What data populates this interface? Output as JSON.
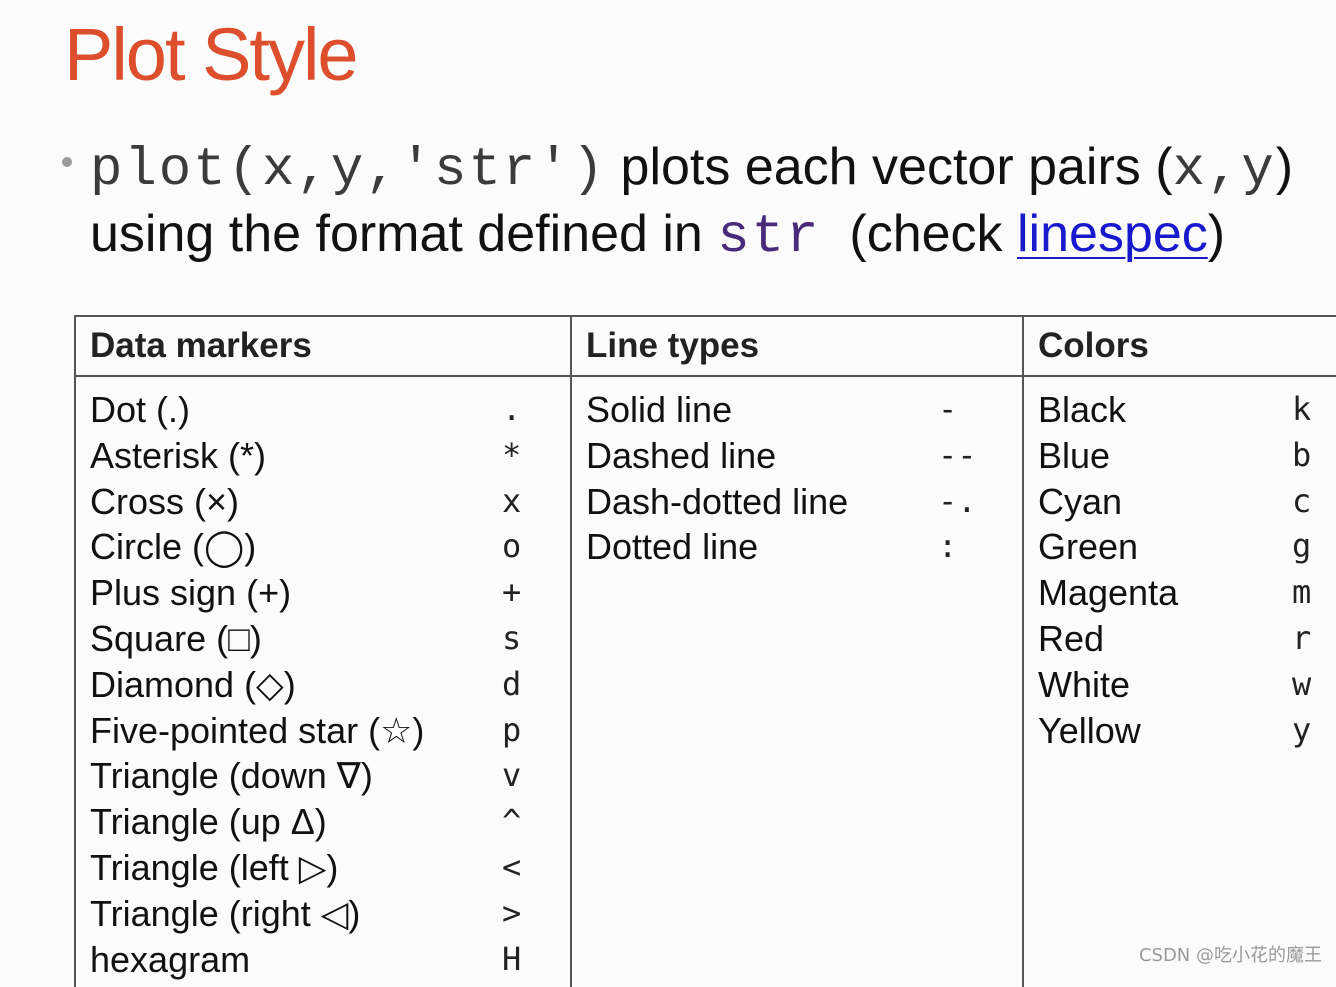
{
  "title": "Plot Style",
  "bullet": {
    "code_call": "plot(x,y,'str')",
    "text_a": " plots each vector pairs (",
    "code_xy": "x,y",
    "text_b": ")",
    "text_c": "using the format defined in ",
    "code_str": "str",
    "text_d": "  (check ",
    "link_text": "linespec",
    "text_e": ")"
  },
  "table": {
    "headers": [
      "Data markers",
      "Line types",
      "Colors"
    ],
    "markers": [
      {
        "label": "Dot (.)",
        "symbol": "."
      },
      {
        "label": "Asterisk (*)",
        "symbol": "*"
      },
      {
        "label": "Cross (×)",
        "symbol": "x"
      },
      {
        "label": "Circle (◯)",
        "symbol": "o"
      },
      {
        "label": "Plus sign (+)",
        "symbol": "+"
      },
      {
        "label": "Square (□)",
        "symbol": "s"
      },
      {
        "label": "Diamond (◇)",
        "symbol": "d"
      },
      {
        "label": "Five-pointed star (☆)",
        "symbol": "p"
      },
      {
        "label": "Triangle (down ∇)",
        "symbol": "v"
      },
      {
        "label": "Triangle (up Δ)",
        "symbol": "^"
      },
      {
        "label": "Triangle (left ▷)",
        "symbol": "<"
      },
      {
        "label": "Triangle (right ◁)",
        "symbol": ">"
      },
      {
        "label": "hexagram",
        "symbol": "H"
      }
    ],
    "line_types": [
      {
        "label": "Solid line",
        "symbol": "-"
      },
      {
        "label": "Dashed line",
        "symbol": "--"
      },
      {
        "label": "Dash-dotted line",
        "symbol": "-."
      },
      {
        "label": "Dotted line",
        "symbol": ":"
      }
    ],
    "colors": [
      {
        "label": "Black",
        "symbol": "k"
      },
      {
        "label": "Blue",
        "symbol": "b"
      },
      {
        "label": "Cyan",
        "symbol": "c"
      },
      {
        "label": "Green",
        "symbol": "g"
      },
      {
        "label": "Magenta",
        "symbol": "m"
      },
      {
        "label": "Red",
        "symbol": "r"
      },
      {
        "label": "White",
        "symbol": "w"
      },
      {
        "label": "Yellow",
        "symbol": "y"
      }
    ]
  },
  "watermark": "CSDN @吃小花的魔王",
  "colors": {
    "title": "#dd4e2c",
    "link": "#1818cc",
    "code_str": "#4a2a7a",
    "border": "#555555"
  }
}
